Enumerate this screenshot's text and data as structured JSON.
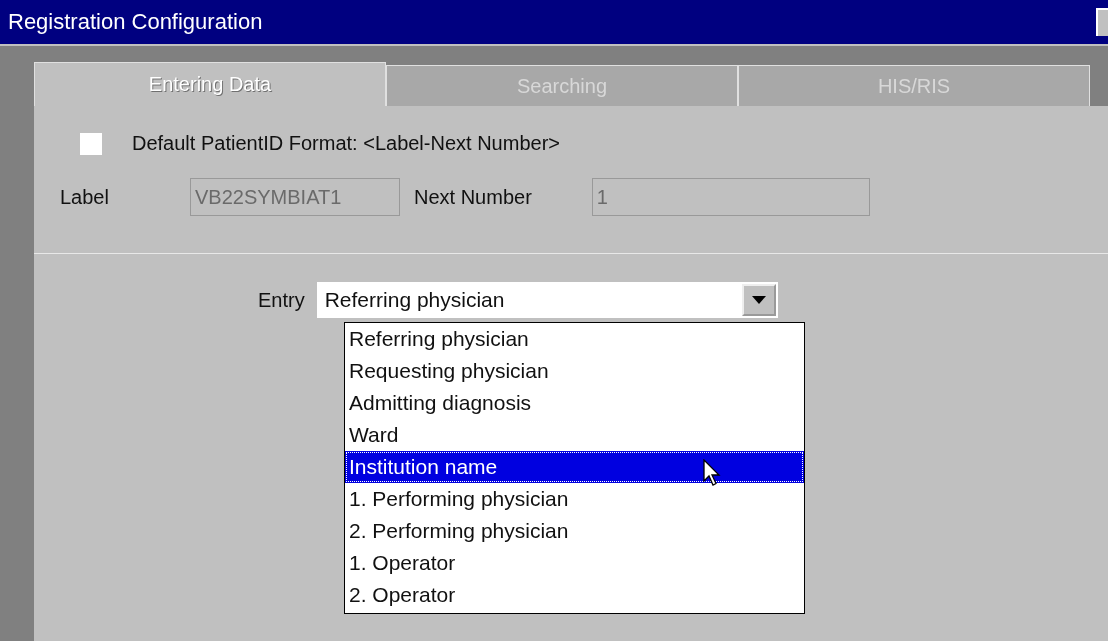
{
  "window": {
    "title": "Registration Configuration"
  },
  "tabs": [
    {
      "label": "Entering Data",
      "selected": true
    },
    {
      "label": "Searching",
      "selected": false
    },
    {
      "label": "HIS/RIS",
      "selected": false
    }
  ],
  "default_format": {
    "checked": false,
    "label": "Default PatientID Format: <Label-Next Number>"
  },
  "label_field": {
    "label": "Label",
    "value": "VB22SYMBIAT1",
    "disabled": true
  },
  "next_number_field": {
    "label": "Next Number",
    "value": "1",
    "disabled": true
  },
  "entry": {
    "label": "Entry",
    "value": "Referring physician",
    "options": [
      {
        "label": "Referring physician",
        "highlighted": false
      },
      {
        "label": "Requesting physician",
        "highlighted": false
      },
      {
        "label": "Admitting diagnosis",
        "highlighted": false
      },
      {
        "label": "Ward",
        "highlighted": false
      },
      {
        "label": "Institution name",
        "highlighted": true
      },
      {
        "label": "1. Performing physician",
        "highlighted": false
      },
      {
        "label": "2. Performing physician",
        "highlighted": false
      },
      {
        "label": "1. Operator",
        "highlighted": false
      },
      {
        "label": "2. Operator",
        "highlighted": false
      }
    ]
  }
}
